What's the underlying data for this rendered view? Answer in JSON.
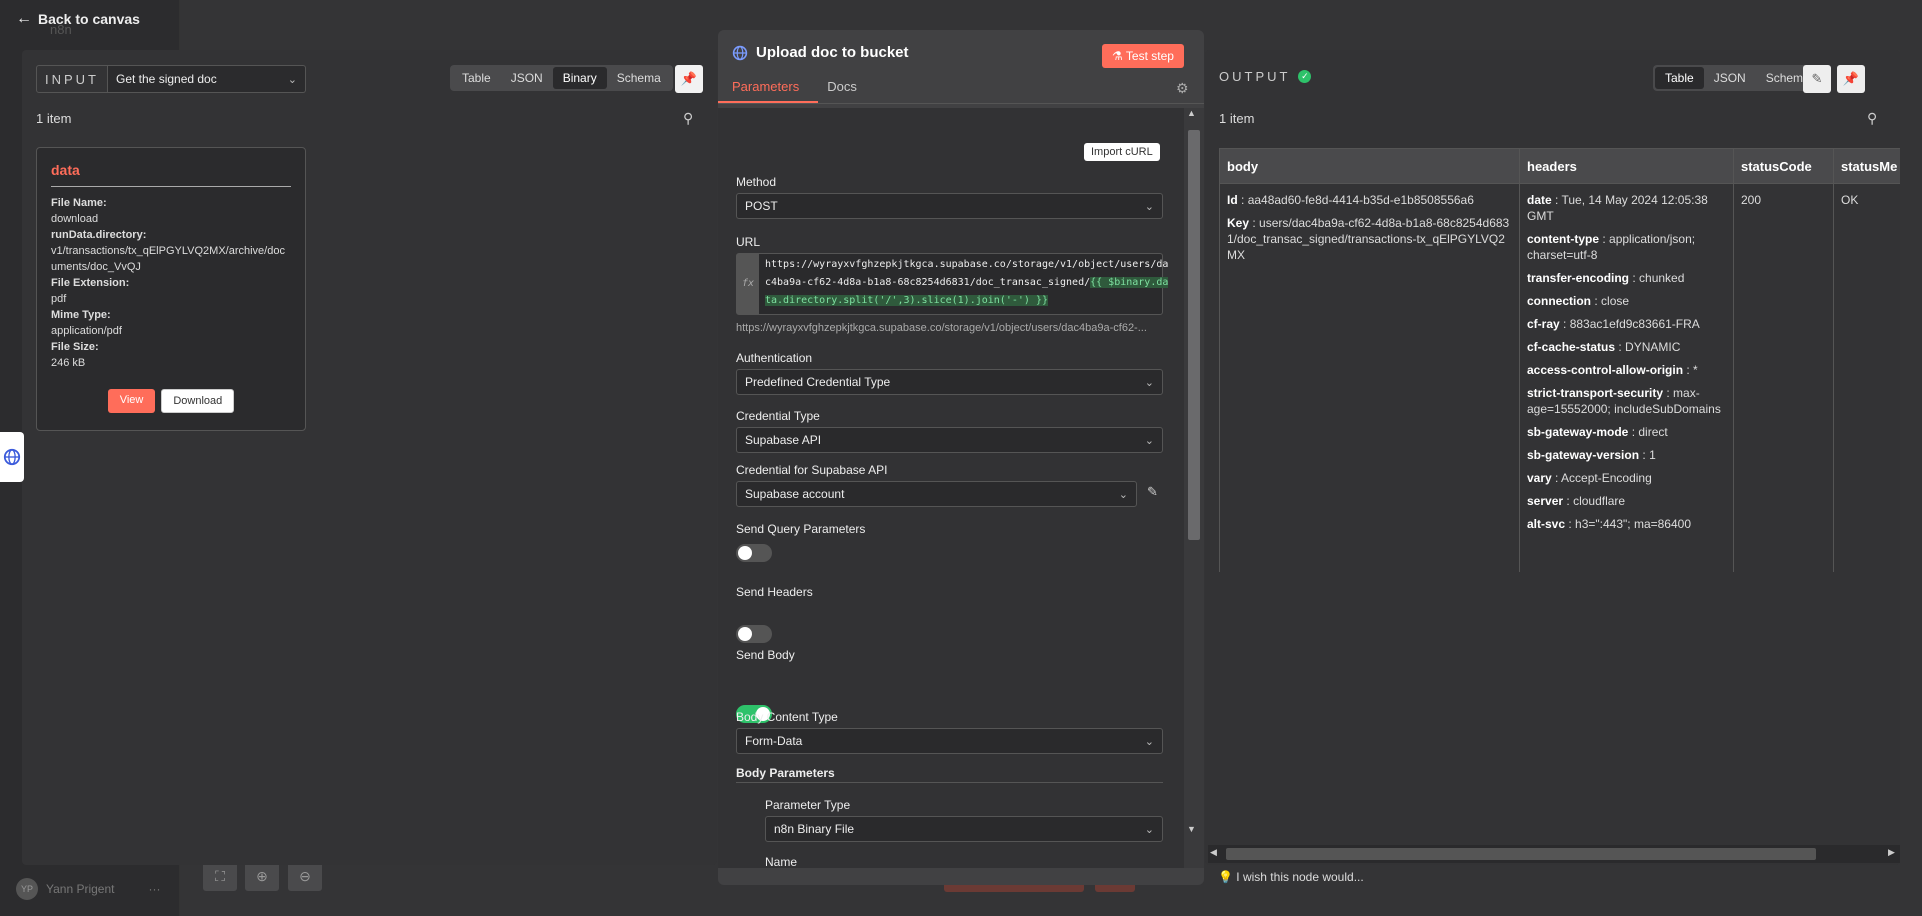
{
  "back": {
    "label": "Back to canvas",
    "ghost": "n8n"
  },
  "input": {
    "label": "INPUT",
    "node_select": "Get the signed doc",
    "tabs": [
      "Table",
      "JSON",
      "Binary",
      "Schema"
    ],
    "active_tab": "Binary",
    "count": "1 item",
    "card": {
      "title": "data",
      "rows": [
        {
          "k": "File Name:",
          "v": "download"
        },
        {
          "k": "runData.directory:",
          "v": "v1/transactions/tx_qElPGYLVQ2MX/archive/documents/doc_VvQJ"
        },
        {
          "k": "File Extension:",
          "v": "pdf"
        },
        {
          "k": "Mime Type:",
          "v": "application/pdf"
        },
        {
          "k": "File Size:",
          "v": "246 kB"
        }
      ],
      "view_label": "View",
      "download_label": "Download"
    }
  },
  "node": {
    "title": "Upload doc to bucket",
    "test_label": "Test step",
    "tabs": {
      "parameters": "Parameters",
      "docs": "Docs"
    },
    "import_curl": "Import cURL",
    "method_label": "Method",
    "method_value": "POST",
    "url_label": "URL",
    "url_line1": "https://wyrayxvfghzepkjtkgca.supabase.co/storage/v1/object/users/da",
    "url_line2_plain": "c4ba9a-cf62-4d8a-b1a8-68c8254d6831/doc_transac_signed/",
    "url_line2_expr": "{{ $binary.da",
    "url_line3_expr": "ta.directory.split('/',3).slice(1).join('-') }}",
    "url_preview": "https://wyrayxvfghzepkjtkgca.supabase.co/storage/v1/object/users/dac4ba9a-cf62-...",
    "auth_label": "Authentication",
    "auth_value": "Predefined Credential Type",
    "cred_type_label": "Credential Type",
    "cred_type_value": "Supabase API",
    "cred_label": "Credential for Supabase API",
    "cred_value": "Supabase account",
    "send_query_label": "Send Query Parameters",
    "send_query_on": false,
    "send_headers_label": "Send Headers",
    "send_headers_on": false,
    "send_body_label": "Send Body",
    "send_body_on": true,
    "body_type_label": "Body Content Type",
    "body_type_value": "Form-Data",
    "body_params_label": "Body Parameters",
    "param_type_label": "Parameter Type",
    "param_type_value": "n8n Binary File",
    "name_label": "Name"
  },
  "output": {
    "label": "OUTPUT",
    "tabs": [
      "Table",
      "JSON",
      "Schema"
    ],
    "active_tab": "Table",
    "count": "1 item",
    "columns": [
      "body",
      "headers",
      "statusCode",
      "statusMe"
    ],
    "body": [
      {
        "k": "Id",
        "v": "aa48ad60-fe8d-4414-b35d-e1b8508556a6"
      },
      {
        "k": "Key",
        "v": "users/dac4ba9a-cf62-4d8a-b1a8-68c8254d6831/doc_transac_signed/transactions-tx_qElPGYLVQ2MX"
      }
    ],
    "headers": [
      {
        "k": "date",
        "v": "Tue, 14 May 2024 12:05:38 GMT"
      },
      {
        "k": "content-type",
        "v": "application/json; charset=utf-8"
      },
      {
        "k": "transfer-encoding",
        "v": "chunked"
      },
      {
        "k": "connection",
        "v": "close"
      },
      {
        "k": "cf-ray",
        "v": "883ac1efd9c83661-FRA"
      },
      {
        "k": "cf-cache-status",
        "v": "DYNAMIC"
      },
      {
        "k": "access-control-allow-origin",
        "v": "*"
      },
      {
        "k": "strict-transport-security",
        "v": "max-age=15552000; includeSubDomains"
      },
      {
        "k": "sb-gateway-mode",
        "v": "direct"
      },
      {
        "k": "sb-gateway-version",
        "v": "1"
      },
      {
        "k": "vary",
        "v": "Accept-Encoding"
      },
      {
        "k": "server",
        "v": "cloudflare"
      },
      {
        "k": "alt-svc",
        "v": "h3=\":443\"; ma=86400"
      }
    ],
    "status_code": "200",
    "status_message": "OK",
    "wish": "I wish this node would..."
  },
  "user": {
    "initials": "YP",
    "name": "Yann Prigent"
  }
}
